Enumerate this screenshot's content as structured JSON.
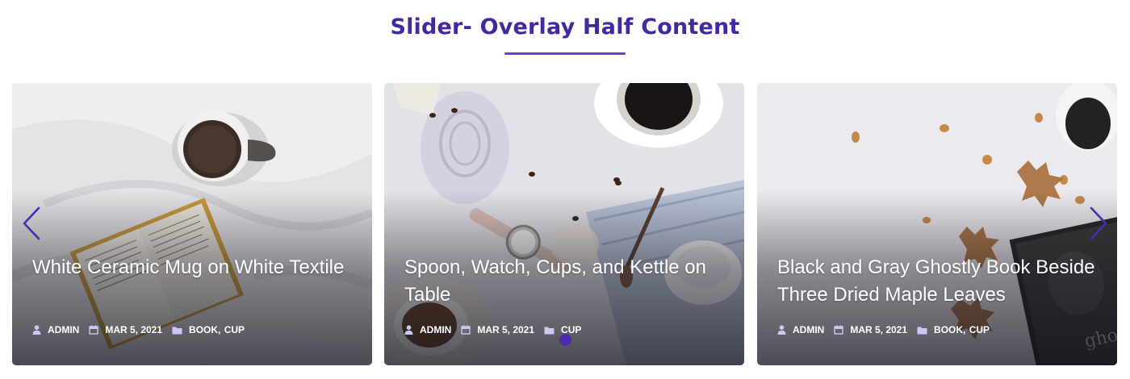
{
  "section": {
    "title": "Slider- Overlay Half Content"
  },
  "slides": [
    {
      "title": "White Ceramic Mug on White Textile",
      "author": "ADMIN",
      "date": "MAR 5, 2021",
      "categories": [
        "BOOK",
        "CUP"
      ]
    },
    {
      "title": "Spoon, Watch, Cups, and Kettle on Table",
      "author": "ADMIN",
      "date": "MAR 5, 2021",
      "categories": [
        "CUP"
      ]
    },
    {
      "title": "Black and Gray Ghostly Book Beside Three Dried Maple Leaves",
      "author": "ADMIN",
      "date": "MAR 5, 2021",
      "categories": [
        "BOOK",
        "CUP"
      ]
    }
  ],
  "navigation": {
    "prev_icon": "chevron-left-icon",
    "next_icon": "chevron-right-icon",
    "accent_color": "#4b2bb0"
  },
  "colors": {
    "title": "#4527a0",
    "underline": "#6a3fc4"
  }
}
